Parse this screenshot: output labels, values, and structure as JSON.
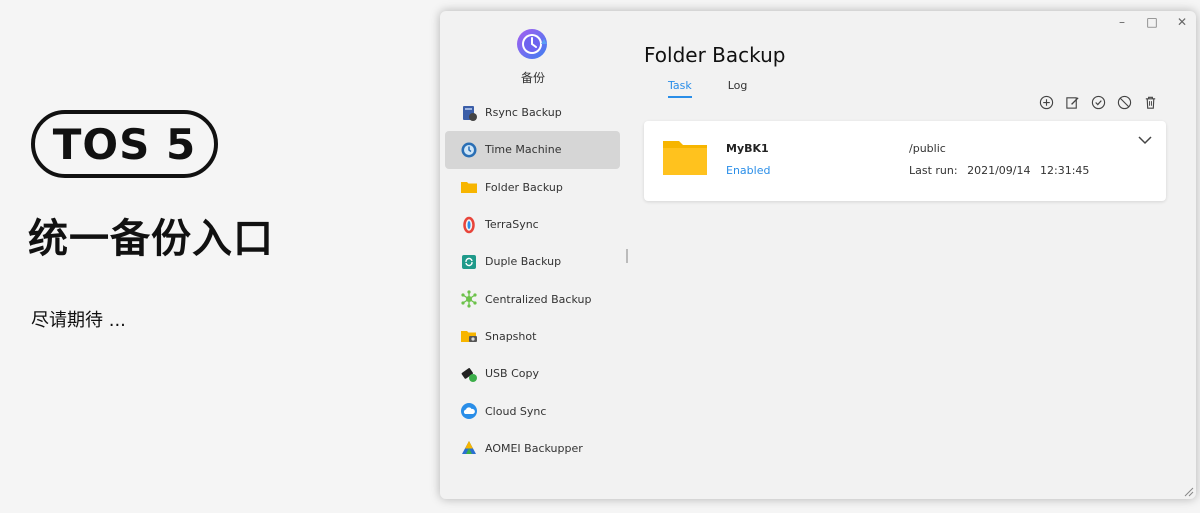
{
  "promo": {
    "badge": "TOS 5",
    "title": "统一备份入口",
    "subtitle": "尽请期待 ..."
  },
  "window": {
    "controls": {
      "minimize": "–",
      "maximize": "□",
      "close": "✕"
    },
    "app_name": "备份",
    "sidebar": {
      "items": [
        {
          "label": "Rsync Backup",
          "icon": "rsync-icon"
        },
        {
          "label": "Time Machine",
          "icon": "time-machine-icon",
          "active": true
        },
        {
          "label": "Folder Backup",
          "icon": "folder-icon"
        },
        {
          "label": "TerraSync",
          "icon": "terrasync-icon"
        },
        {
          "label": "Duple Backup",
          "icon": "duple-backup-icon"
        },
        {
          "label": "Centralized Backup",
          "icon": "centralized-backup-icon"
        },
        {
          "label": "Snapshot",
          "icon": "snapshot-icon"
        },
        {
          "label": "USB Copy",
          "icon": "usb-copy-icon"
        },
        {
          "label": "Cloud Sync",
          "icon": "cloud-sync-icon"
        },
        {
          "label": "AOMEI Backupper",
          "icon": "aomei-icon"
        }
      ]
    },
    "main": {
      "title": "Folder Backup",
      "tabs": [
        {
          "label": "Task",
          "active": true
        },
        {
          "label": "Log",
          "active": false
        }
      ],
      "toolbar": [
        "add-icon",
        "edit-icon",
        "check-icon",
        "disable-icon",
        "delete-icon"
      ],
      "task": {
        "name": "MyBK1",
        "status": "Enabled",
        "path": "/public",
        "last_run_label": "Last run:",
        "last_run_date": "2021/09/14",
        "last_run_time": "12:31:45"
      }
    }
  },
  "colors": {
    "accent": "#2a8ee8",
    "folder": "#f7b500",
    "background": "#f5f5f5"
  }
}
